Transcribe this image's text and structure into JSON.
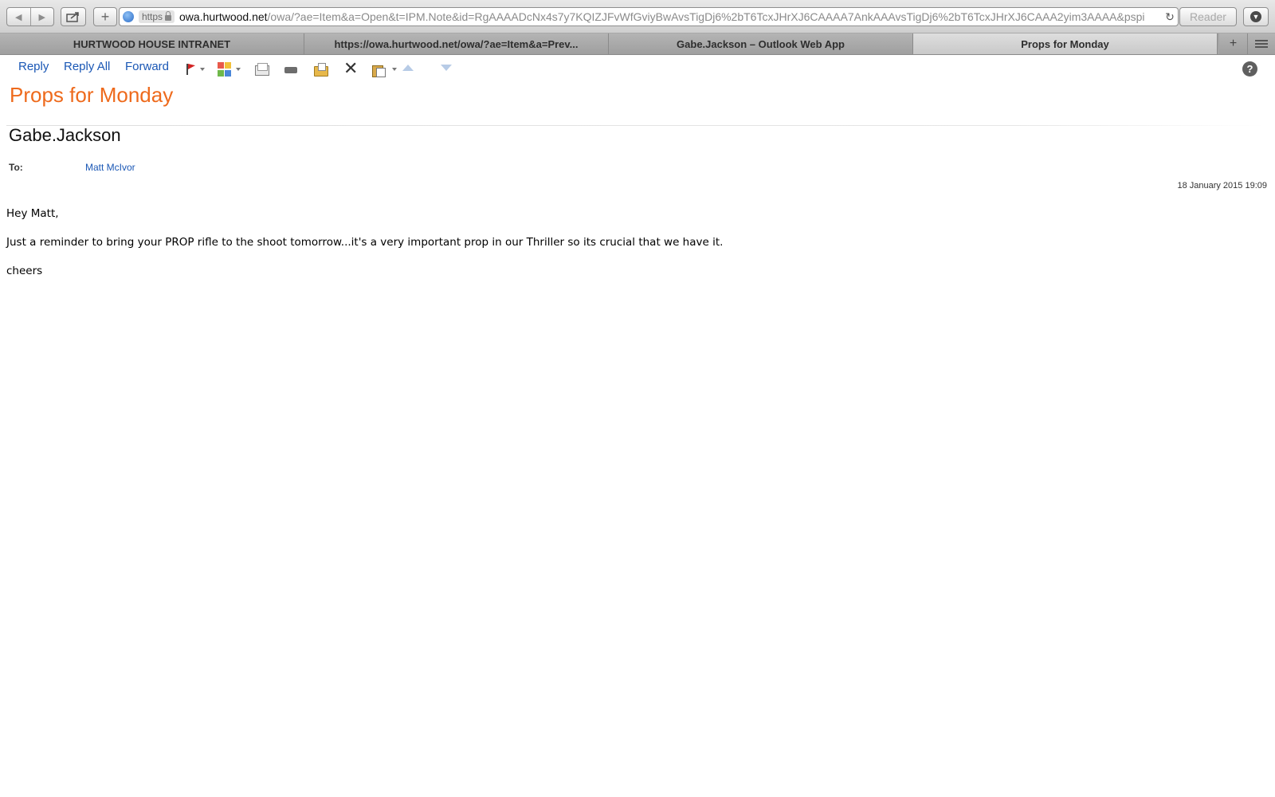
{
  "browser": {
    "url_scheme": "https",
    "url_host": "owa.hurtwood.net",
    "url_path": "/owa/?ae=Item&a=Open&t=IPM.Note&id=RgAAAADcNx4s7y7KQIZJFvWfGviyBwAvsTigDj6%2bT6TcxJHrXJ6CAAAA7AnkAAAvsTigDj6%2bT6TcxJHrXJ6CAAA2yim3AAAA&pspi",
    "reader_label": "Reader",
    "tabs": [
      {
        "label": "HURTWOOD HOUSE INTRANET",
        "active": false
      },
      {
        "label": "https://owa.hurtwood.net/owa/?ae=Item&a=Prev...",
        "active": false
      },
      {
        "label": "Gabe.Jackson – Outlook Web App",
        "active": false
      },
      {
        "label": "Props for Monday",
        "active": true
      }
    ]
  },
  "toolbar": {
    "reply_label": "Reply",
    "reply_all_label": "Reply All",
    "forward_label": "Forward",
    "icons": [
      "flag-icon",
      "categorize-icon",
      "envelope-icon",
      "print-icon",
      "move-icon",
      "delete-icon",
      "clipboard-icon",
      "previous-item-icon",
      "next-item-icon",
      "help-icon"
    ],
    "category_colors": [
      "#e8594b",
      "#f2c13a",
      "#6fb84a",
      "#4a86d8"
    ]
  },
  "message": {
    "subject": "Props for Monday",
    "sender": "Gabe.Jackson",
    "to_label": "To:",
    "to_value": "Matt McIvor",
    "date": "18 January 2015 19:09",
    "body": [
      "Hey Matt,",
      "Just a reminder to bring your PROP rifle to the shoot tomorrow...it's a very important prop in our Thriller so its crucial that we have it.",
      "cheers"
    ]
  },
  "colors": {
    "subject": "#ee6a1c",
    "link": "#1a57b5"
  }
}
